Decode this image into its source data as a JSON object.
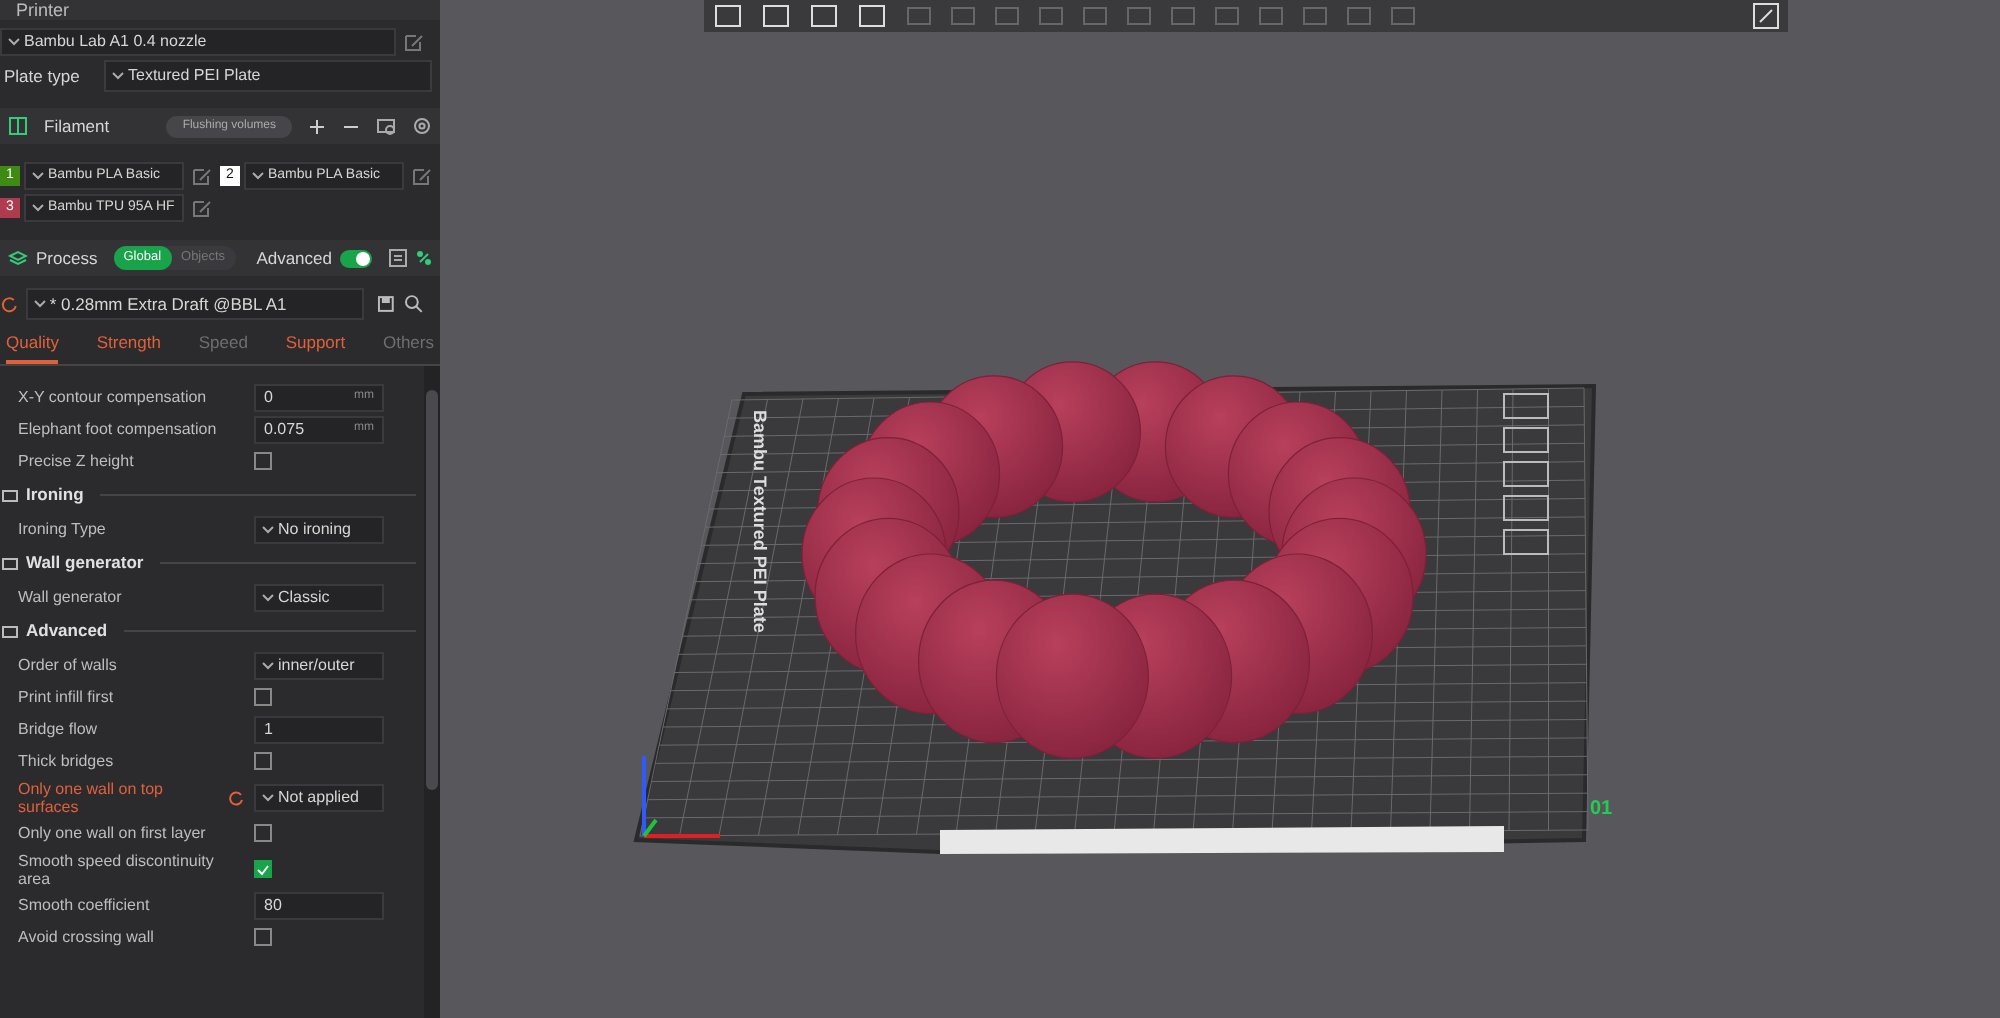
{
  "printer": {
    "title": "Printer",
    "preset": "Bambu Lab A1 0.4 nozzle",
    "plate_label": "Plate type",
    "plate_type": "Textured PEI Plate"
  },
  "filament": {
    "title": "Filament",
    "flushing_button": "Flushing volumes",
    "slots": [
      {
        "number": "1",
        "name": "Bambu PLA Basic",
        "color": "#3f8a12"
      },
      {
        "number": "2",
        "name": "Bambu PLA Basic",
        "color": "#ffffff"
      },
      {
        "number": "3",
        "name": "Bambu TPU 95A HF",
        "color": "#b03a4e"
      }
    ]
  },
  "process": {
    "title": "Process",
    "scopes": [
      {
        "label": "Global",
        "selected": true
      },
      {
        "label": "Objects",
        "selected": false
      }
    ],
    "advanced_label": "Advanced",
    "advanced_on": true,
    "preset": "* 0.28mm Extra Draft @BBL A1",
    "tabs": [
      {
        "label": "Quality",
        "selected": true,
        "modified": true
      },
      {
        "label": "Strength",
        "selected": false,
        "modified": true
      },
      {
        "label": "Speed",
        "selected": false,
        "modified": false
      },
      {
        "label": "Support",
        "selected": false,
        "modified": true
      },
      {
        "label": "Others",
        "selected": false,
        "modified": false
      }
    ],
    "settings": [
      {
        "kind": "input",
        "label": "X-Y contour compensation",
        "value": "0",
        "unit": "mm",
        "modified": false
      },
      {
        "kind": "input",
        "label": "Elephant foot compensation",
        "value": "0.075",
        "unit": "mm",
        "modified": false
      },
      {
        "kind": "checkbox",
        "label": "Precise Z height",
        "checked": false,
        "modified": false
      },
      {
        "kind": "section",
        "label": "Ironing"
      },
      {
        "kind": "combo",
        "label": "Ironing Type",
        "value": "No ironing",
        "modified": false
      },
      {
        "kind": "section",
        "label": "Wall generator"
      },
      {
        "kind": "combo",
        "label": "Wall generator",
        "value": "Classic",
        "modified": false
      },
      {
        "kind": "section",
        "label": "Advanced"
      },
      {
        "kind": "combo",
        "label": "Order of walls",
        "value": "inner/outer",
        "modified": false
      },
      {
        "kind": "checkbox",
        "label": "Print infill first",
        "checked": false,
        "modified": false
      },
      {
        "kind": "input",
        "label": "Bridge flow",
        "value": "1",
        "modified": false
      },
      {
        "kind": "checkbox",
        "label": "Thick bridges",
        "checked": false,
        "modified": false
      },
      {
        "kind": "combo",
        "label": "Only one wall on top surfaces",
        "value": "Not applied",
        "modified": true
      },
      {
        "kind": "checkbox",
        "label": "Only one wall on first layer",
        "checked": false,
        "modified": false
      },
      {
        "kind": "checkbox",
        "label": "Smooth speed discontinuity area",
        "checked": true,
        "modified": false
      },
      {
        "kind": "input",
        "label": "Smooth coefficient",
        "value": "80",
        "modified": false
      },
      {
        "kind": "checkbox",
        "label": "Avoid crossing wall",
        "checked": false,
        "modified": false
      }
    ]
  },
  "viewport": {
    "plate_label": "Bambu Textured PEI Plate",
    "plate_number": "01"
  }
}
